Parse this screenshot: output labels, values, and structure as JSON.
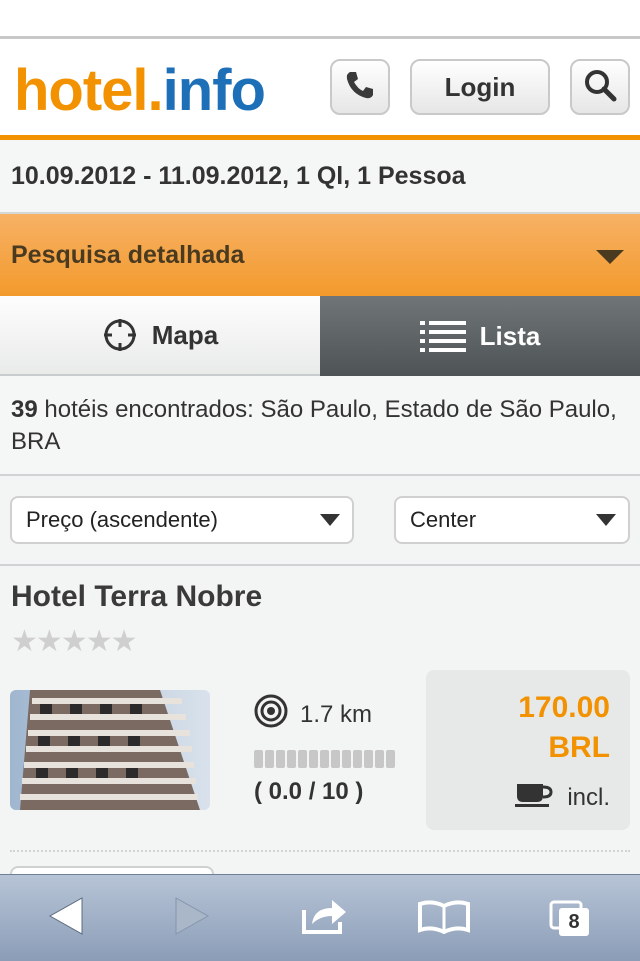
{
  "header": {
    "logo_hotel": "hotel",
    "logo_dot": ".",
    "logo_info": "info",
    "login_label": "Login"
  },
  "search_summary": "10.09.2012 - 11.09.2012, 1 Ql, 1 Pessoa",
  "detailed_search_label": "Pesquisa detalhada",
  "tabs": [
    {
      "label": "Mapa",
      "icon": "crosshair-icon",
      "active": false
    },
    {
      "label": "Lista",
      "icon": "list-icon",
      "active": true
    }
  ],
  "results": {
    "count": "39",
    "text": " hotéis encontrados: São Paulo, Estado de São Paulo, BRA"
  },
  "filters": {
    "sort_value": "Preço (ascendente)",
    "location_value": "Center"
  },
  "hotel": {
    "name": "Hotel Terra Nobre",
    "stars_total": 5,
    "stars_filled": 0,
    "distance": "1.7 km",
    "rating_score": "( 0.0 / 10 )",
    "rating_value": 0.0,
    "price_amount": "170.00",
    "price_currency": "BRL",
    "breakfast_label": "incl."
  },
  "toolbar": {
    "tabs_count": "8"
  },
  "colors": {
    "brand_orange": "#f39200",
    "brand_blue": "#1d6fb8",
    "toolbar": "#9aabc3"
  }
}
